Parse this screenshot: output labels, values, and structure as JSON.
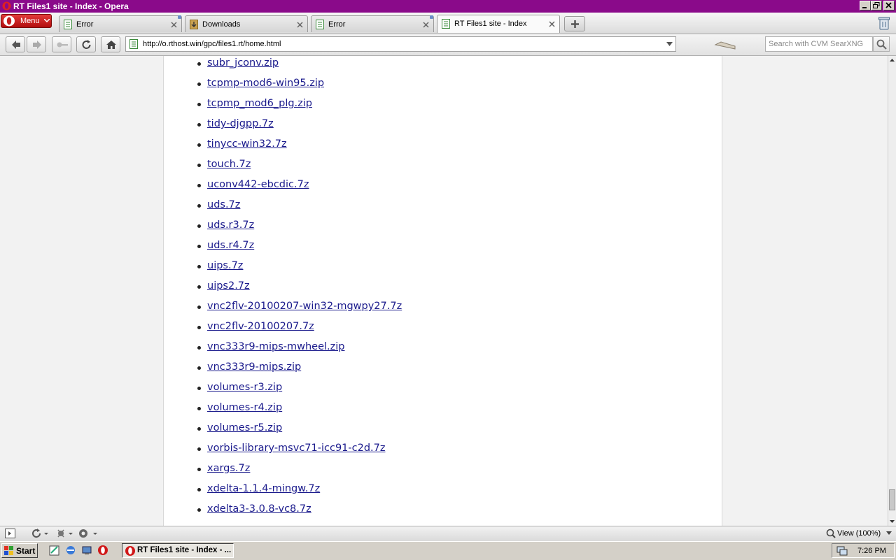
{
  "window": {
    "title": "RT Files1 site - Index - Opera"
  },
  "menu": {
    "label": "Menu"
  },
  "tabs": [
    {
      "label": "Error"
    },
    {
      "label": "Downloads"
    },
    {
      "label": "Error"
    },
    {
      "label": "RT Files1 site - Index"
    }
  ],
  "address": {
    "url": "http://o.rthost.win/gpc/files1.rt/home.html"
  },
  "search": {
    "placeholder": "Search with CVM SearXNG"
  },
  "files": [
    "subr_jconv.zip",
    "tcpmp-mod6-win95.zip",
    "tcpmp_mod6_plg.zip",
    "tidy-djgpp.7z",
    "tinycc-win32.7z",
    "touch.7z",
    "uconv442-ebcdic.7z",
    "uds.7z",
    "uds.r3.7z",
    "uds.r4.7z",
    "uips.7z",
    "uips2.7z",
    "vnc2flv-20100207-win32-mgwpy27.7z",
    "vnc2flv-20100207.7z",
    "vnc333r9-mips-mwheel.zip",
    "vnc333r9-mips.zip",
    "volumes-r3.zip",
    "volumes-r4.zip",
    "volumes-r5.zip",
    "vorbis-library-msvc71-icc91-c2d.7z",
    "xargs.7z",
    "xdelta-1.1.4-mingw.7z",
    "xdelta3-3.0.8-vc8.7z"
  ],
  "status": {
    "zoom": "View (100%)"
  },
  "taskbar": {
    "start": "Start",
    "task_label": "RT Files1 site - Index - ...",
    "clock": "7:26 PM"
  },
  "colors": {
    "titlebar": "#8a0a8a",
    "link": "#1a1a8c",
    "menu_button": "#c41e1e"
  }
}
